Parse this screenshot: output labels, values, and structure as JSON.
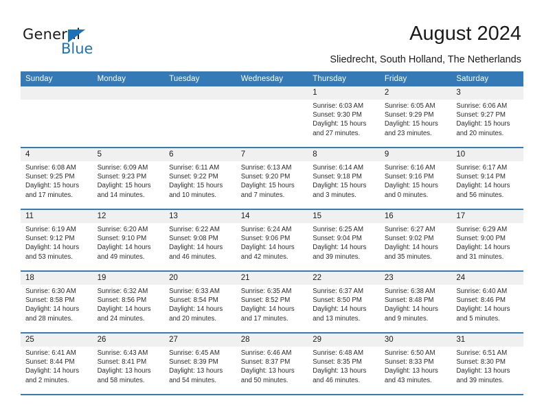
{
  "brand": {
    "name_part1": "General",
    "name_part2": "Blue",
    "triangle_icon": "triangle-icon",
    "accent_color": "#1b72b8"
  },
  "header": {
    "title": "August 2024",
    "subtitle": "Sliedrecht, South Holland, The Netherlands"
  },
  "calendar": {
    "header_color": "#337ab7",
    "daynum_background": "#f0f0f0",
    "weekday_headers": [
      "Sunday",
      "Monday",
      "Tuesday",
      "Wednesday",
      "Thursday",
      "Friday",
      "Saturday"
    ],
    "weeks": [
      [
        {
          "day": "",
          "empty": true
        },
        {
          "day": "",
          "empty": true
        },
        {
          "day": "",
          "empty": true
        },
        {
          "day": "",
          "empty": true
        },
        {
          "day": "1",
          "sunrise": "Sunrise: 6:03 AM",
          "sunset": "Sunset: 9:30 PM",
          "daylight": "Daylight: 15 hours and 27 minutes."
        },
        {
          "day": "2",
          "sunrise": "Sunrise: 6:05 AM",
          "sunset": "Sunset: 9:29 PM",
          "daylight": "Daylight: 15 hours and 23 minutes."
        },
        {
          "day": "3",
          "sunrise": "Sunrise: 6:06 AM",
          "sunset": "Sunset: 9:27 PM",
          "daylight": "Daylight: 15 hours and 20 minutes."
        }
      ],
      [
        {
          "day": "4",
          "sunrise": "Sunrise: 6:08 AM",
          "sunset": "Sunset: 9:25 PM",
          "daylight": "Daylight: 15 hours and 17 minutes."
        },
        {
          "day": "5",
          "sunrise": "Sunrise: 6:09 AM",
          "sunset": "Sunset: 9:23 PM",
          "daylight": "Daylight: 15 hours and 14 minutes."
        },
        {
          "day": "6",
          "sunrise": "Sunrise: 6:11 AM",
          "sunset": "Sunset: 9:22 PM",
          "daylight": "Daylight: 15 hours and 10 minutes."
        },
        {
          "day": "7",
          "sunrise": "Sunrise: 6:13 AM",
          "sunset": "Sunset: 9:20 PM",
          "daylight": "Daylight: 15 hours and 7 minutes."
        },
        {
          "day": "8",
          "sunrise": "Sunrise: 6:14 AM",
          "sunset": "Sunset: 9:18 PM",
          "daylight": "Daylight: 15 hours and 3 minutes."
        },
        {
          "day": "9",
          "sunrise": "Sunrise: 6:16 AM",
          "sunset": "Sunset: 9:16 PM",
          "daylight": "Daylight: 15 hours and 0 minutes."
        },
        {
          "day": "10",
          "sunrise": "Sunrise: 6:17 AM",
          "sunset": "Sunset: 9:14 PM",
          "daylight": "Daylight: 14 hours and 56 minutes."
        }
      ],
      [
        {
          "day": "11",
          "sunrise": "Sunrise: 6:19 AM",
          "sunset": "Sunset: 9:12 PM",
          "daylight": "Daylight: 14 hours and 53 minutes."
        },
        {
          "day": "12",
          "sunrise": "Sunrise: 6:20 AM",
          "sunset": "Sunset: 9:10 PM",
          "daylight": "Daylight: 14 hours and 49 minutes."
        },
        {
          "day": "13",
          "sunrise": "Sunrise: 6:22 AM",
          "sunset": "Sunset: 9:08 PM",
          "daylight": "Daylight: 14 hours and 46 minutes."
        },
        {
          "day": "14",
          "sunrise": "Sunrise: 6:24 AM",
          "sunset": "Sunset: 9:06 PM",
          "daylight": "Daylight: 14 hours and 42 minutes."
        },
        {
          "day": "15",
          "sunrise": "Sunrise: 6:25 AM",
          "sunset": "Sunset: 9:04 PM",
          "daylight": "Daylight: 14 hours and 39 minutes."
        },
        {
          "day": "16",
          "sunrise": "Sunrise: 6:27 AM",
          "sunset": "Sunset: 9:02 PM",
          "daylight": "Daylight: 14 hours and 35 minutes."
        },
        {
          "day": "17",
          "sunrise": "Sunrise: 6:29 AM",
          "sunset": "Sunset: 9:00 PM",
          "daylight": "Daylight: 14 hours and 31 minutes."
        }
      ],
      [
        {
          "day": "18",
          "sunrise": "Sunrise: 6:30 AM",
          "sunset": "Sunset: 8:58 PM",
          "daylight": "Daylight: 14 hours and 28 minutes."
        },
        {
          "day": "19",
          "sunrise": "Sunrise: 6:32 AM",
          "sunset": "Sunset: 8:56 PM",
          "daylight": "Daylight: 14 hours and 24 minutes."
        },
        {
          "day": "20",
          "sunrise": "Sunrise: 6:33 AM",
          "sunset": "Sunset: 8:54 PM",
          "daylight": "Daylight: 14 hours and 20 minutes."
        },
        {
          "day": "21",
          "sunrise": "Sunrise: 6:35 AM",
          "sunset": "Sunset: 8:52 PM",
          "daylight": "Daylight: 14 hours and 17 minutes."
        },
        {
          "day": "22",
          "sunrise": "Sunrise: 6:37 AM",
          "sunset": "Sunset: 8:50 PM",
          "daylight": "Daylight: 14 hours and 13 minutes."
        },
        {
          "day": "23",
          "sunrise": "Sunrise: 6:38 AM",
          "sunset": "Sunset: 8:48 PM",
          "daylight": "Daylight: 14 hours and 9 minutes."
        },
        {
          "day": "24",
          "sunrise": "Sunrise: 6:40 AM",
          "sunset": "Sunset: 8:46 PM",
          "daylight": "Daylight: 14 hours and 5 minutes."
        }
      ],
      [
        {
          "day": "25",
          "sunrise": "Sunrise: 6:41 AM",
          "sunset": "Sunset: 8:44 PM",
          "daylight": "Daylight: 14 hours and 2 minutes."
        },
        {
          "day": "26",
          "sunrise": "Sunrise: 6:43 AM",
          "sunset": "Sunset: 8:41 PM",
          "daylight": "Daylight: 13 hours and 58 minutes."
        },
        {
          "day": "27",
          "sunrise": "Sunrise: 6:45 AM",
          "sunset": "Sunset: 8:39 PM",
          "daylight": "Daylight: 13 hours and 54 minutes."
        },
        {
          "day": "28",
          "sunrise": "Sunrise: 6:46 AM",
          "sunset": "Sunset: 8:37 PM",
          "daylight": "Daylight: 13 hours and 50 minutes."
        },
        {
          "day": "29",
          "sunrise": "Sunrise: 6:48 AM",
          "sunset": "Sunset: 8:35 PM",
          "daylight": "Daylight: 13 hours and 46 minutes."
        },
        {
          "day": "30",
          "sunrise": "Sunrise: 6:50 AM",
          "sunset": "Sunset: 8:33 PM",
          "daylight": "Daylight: 13 hours and 43 minutes."
        },
        {
          "day": "31",
          "sunrise": "Sunrise: 6:51 AM",
          "sunset": "Sunset: 8:30 PM",
          "daylight": "Daylight: 13 hours and 39 minutes."
        }
      ]
    ]
  }
}
